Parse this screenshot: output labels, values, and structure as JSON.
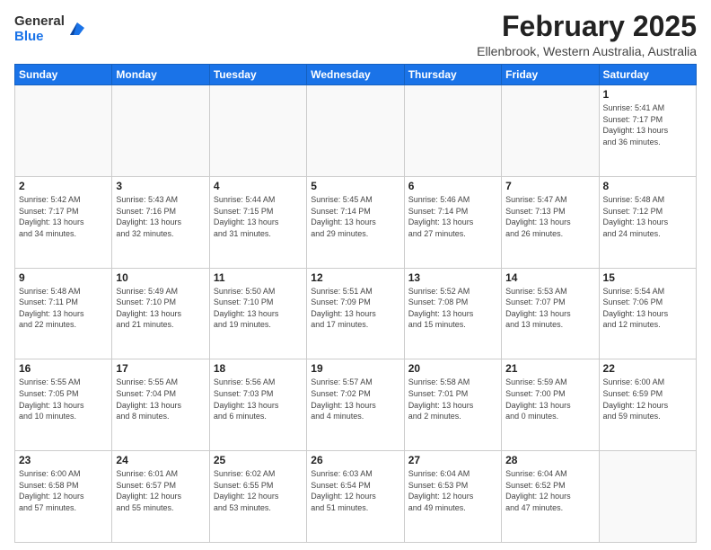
{
  "logo": {
    "general": "General",
    "blue": "Blue"
  },
  "header": {
    "title": "February 2025",
    "subtitle": "Ellenbrook, Western Australia, Australia"
  },
  "weekdays": [
    "Sunday",
    "Monday",
    "Tuesday",
    "Wednesday",
    "Thursday",
    "Friday",
    "Saturday"
  ],
  "weeks": [
    [
      {
        "day": "",
        "info": ""
      },
      {
        "day": "",
        "info": ""
      },
      {
        "day": "",
        "info": ""
      },
      {
        "day": "",
        "info": ""
      },
      {
        "day": "",
        "info": ""
      },
      {
        "day": "",
        "info": ""
      },
      {
        "day": "1",
        "info": "Sunrise: 5:41 AM\nSunset: 7:17 PM\nDaylight: 13 hours\nand 36 minutes."
      }
    ],
    [
      {
        "day": "2",
        "info": "Sunrise: 5:42 AM\nSunset: 7:17 PM\nDaylight: 13 hours\nand 34 minutes."
      },
      {
        "day": "3",
        "info": "Sunrise: 5:43 AM\nSunset: 7:16 PM\nDaylight: 13 hours\nand 32 minutes."
      },
      {
        "day": "4",
        "info": "Sunrise: 5:44 AM\nSunset: 7:15 PM\nDaylight: 13 hours\nand 31 minutes."
      },
      {
        "day": "5",
        "info": "Sunrise: 5:45 AM\nSunset: 7:14 PM\nDaylight: 13 hours\nand 29 minutes."
      },
      {
        "day": "6",
        "info": "Sunrise: 5:46 AM\nSunset: 7:14 PM\nDaylight: 13 hours\nand 27 minutes."
      },
      {
        "day": "7",
        "info": "Sunrise: 5:47 AM\nSunset: 7:13 PM\nDaylight: 13 hours\nand 26 minutes."
      },
      {
        "day": "8",
        "info": "Sunrise: 5:48 AM\nSunset: 7:12 PM\nDaylight: 13 hours\nand 24 minutes."
      }
    ],
    [
      {
        "day": "9",
        "info": "Sunrise: 5:48 AM\nSunset: 7:11 PM\nDaylight: 13 hours\nand 22 minutes."
      },
      {
        "day": "10",
        "info": "Sunrise: 5:49 AM\nSunset: 7:10 PM\nDaylight: 13 hours\nand 21 minutes."
      },
      {
        "day": "11",
        "info": "Sunrise: 5:50 AM\nSunset: 7:10 PM\nDaylight: 13 hours\nand 19 minutes."
      },
      {
        "day": "12",
        "info": "Sunrise: 5:51 AM\nSunset: 7:09 PM\nDaylight: 13 hours\nand 17 minutes."
      },
      {
        "day": "13",
        "info": "Sunrise: 5:52 AM\nSunset: 7:08 PM\nDaylight: 13 hours\nand 15 minutes."
      },
      {
        "day": "14",
        "info": "Sunrise: 5:53 AM\nSunset: 7:07 PM\nDaylight: 13 hours\nand 13 minutes."
      },
      {
        "day": "15",
        "info": "Sunrise: 5:54 AM\nSunset: 7:06 PM\nDaylight: 13 hours\nand 12 minutes."
      }
    ],
    [
      {
        "day": "16",
        "info": "Sunrise: 5:55 AM\nSunset: 7:05 PM\nDaylight: 13 hours\nand 10 minutes."
      },
      {
        "day": "17",
        "info": "Sunrise: 5:55 AM\nSunset: 7:04 PM\nDaylight: 13 hours\nand 8 minutes."
      },
      {
        "day": "18",
        "info": "Sunrise: 5:56 AM\nSunset: 7:03 PM\nDaylight: 13 hours\nand 6 minutes."
      },
      {
        "day": "19",
        "info": "Sunrise: 5:57 AM\nSunset: 7:02 PM\nDaylight: 13 hours\nand 4 minutes."
      },
      {
        "day": "20",
        "info": "Sunrise: 5:58 AM\nSunset: 7:01 PM\nDaylight: 13 hours\nand 2 minutes."
      },
      {
        "day": "21",
        "info": "Sunrise: 5:59 AM\nSunset: 7:00 PM\nDaylight: 13 hours\nand 0 minutes."
      },
      {
        "day": "22",
        "info": "Sunrise: 6:00 AM\nSunset: 6:59 PM\nDaylight: 12 hours\nand 59 minutes."
      }
    ],
    [
      {
        "day": "23",
        "info": "Sunrise: 6:00 AM\nSunset: 6:58 PM\nDaylight: 12 hours\nand 57 minutes."
      },
      {
        "day": "24",
        "info": "Sunrise: 6:01 AM\nSunset: 6:57 PM\nDaylight: 12 hours\nand 55 minutes."
      },
      {
        "day": "25",
        "info": "Sunrise: 6:02 AM\nSunset: 6:55 PM\nDaylight: 12 hours\nand 53 minutes."
      },
      {
        "day": "26",
        "info": "Sunrise: 6:03 AM\nSunset: 6:54 PM\nDaylight: 12 hours\nand 51 minutes."
      },
      {
        "day": "27",
        "info": "Sunrise: 6:04 AM\nSunset: 6:53 PM\nDaylight: 12 hours\nand 49 minutes."
      },
      {
        "day": "28",
        "info": "Sunrise: 6:04 AM\nSunset: 6:52 PM\nDaylight: 12 hours\nand 47 minutes."
      },
      {
        "day": "",
        "info": ""
      }
    ]
  ]
}
